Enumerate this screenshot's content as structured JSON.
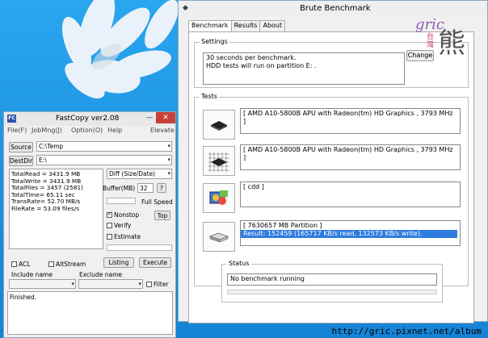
{
  "fastcopy": {
    "title": "FastCopy ver2.08",
    "app_icon": "FC",
    "menu": [
      "File(F)",
      "JobMng(J)",
      "Option(O)",
      "Help"
    ],
    "elevate": "Elevate",
    "source_label": "Source",
    "source_value": "C:\\Temp",
    "destdir_label": "DestDir",
    "destdir_value": "E:\\",
    "stats": [
      "TotalRead = 3431.9 MB",
      "TotalWrite = 3431.9 MB",
      "TotalFiles = 3457 (2581)",
      "TotalTime= 65.11 sec",
      "TransRate= 52.70 MB/s",
      "FileRate = 53.09 files/s"
    ],
    "mode_value": "Diff (Size/Date)",
    "buffer_label": "Buffer(MB)",
    "buffer_value": "32",
    "help_btn": "?",
    "full_speed": "Full Speed",
    "nonstop_label": "Nonstop",
    "top_btn": "Top",
    "verify_label": "Verify",
    "estimate_label": "Estimate",
    "listing_btn": "Listing",
    "execute_btn": "Execute",
    "acl_label": "ACL",
    "altstream_label": "AltStream",
    "include_label": "Include name",
    "exclude_label": "Exclude name",
    "filter_label": "Filter",
    "status_text": "Finished."
  },
  "brute": {
    "title": "Brute Benchmark",
    "tabs": [
      "Benchmark",
      "Results",
      "About"
    ],
    "settings_label": "Settings",
    "settings_lines": [
      "30 seconds per benchmark.",
      "HDD tests will run on partition E: ."
    ],
    "change_btn": "Change",
    "tests_label": "Tests",
    "tests": [
      {
        "text": "[ AMD A10-5800B APU with Radeon(tm) HD Graphics  , 3793 MHz ]",
        "icon": "cpu-chip-icon"
      },
      {
        "text": "[ AMD A10-5800B APU with Radeon(tm) HD Graphics  , 3793 MHz ]",
        "icon": "cpu-grid-icon"
      },
      {
        "text": "[ cdd ]",
        "icon": "graphics-app-icon"
      },
      {
        "text": "[ 7630657 MB Partition ]",
        "result": "Result: 152459 (165717 KB/s read, 132573 KB/s  write).",
        "icon": "hard-drive-icon"
      }
    ],
    "status_label": "Status",
    "status_text": "No benchmark running"
  },
  "watermark": {
    "text": "gric",
    "kanji_top": "台",
    "kanji_bottom": "灣",
    "kanji_big": "熊"
  },
  "footer_url": "http://gric.pixnet.net/album",
  "colors": {
    "accent": "#2f7ce0",
    "close": "#c7413a",
    "desktop": "#1e9de6"
  }
}
